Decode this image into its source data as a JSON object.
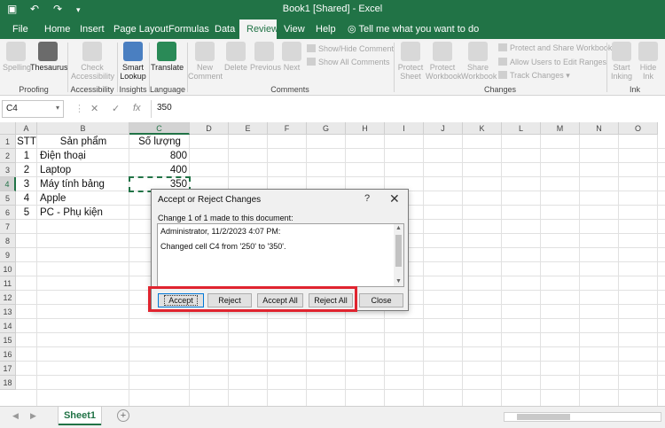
{
  "titlebar": {
    "title": "Book1  [Shared]  -  Excel",
    "save_icon": "save-icon",
    "undo_icon": "undo-icon",
    "redo_icon": "redo-icon",
    "customize_icon": "customize-icon",
    "bg_color": "#217346"
  },
  "tabs": [
    {
      "label": "File"
    },
    {
      "label": "Home"
    },
    {
      "label": "Insert"
    },
    {
      "label": "Page Layout"
    },
    {
      "label": "Formulas"
    },
    {
      "label": "Data"
    },
    {
      "label": "Review"
    },
    {
      "label": "View"
    },
    {
      "label": "Help"
    }
  ],
  "active_tab": "Review",
  "tell_me": "Tell me what you want to do",
  "ribbon": {
    "spelling": "Spelling",
    "thesaurus": "Thesaurus",
    "check_accessibility_1": "Check",
    "check_accessibility_2": "Accessibility",
    "smart_lookup_1": "Smart",
    "smart_lookup_2": "Lookup",
    "translate": "Translate",
    "new_comment_1": "New",
    "new_comment_2": "Comment",
    "delete": "Delete",
    "previous": "Previous",
    "next": "Next",
    "show_hide_comment": "Show/Hide Comment",
    "show_all_comments": "Show All Comments",
    "protect_sheet_1": "Protect",
    "protect_sheet_2": "Sheet",
    "protect_workbook_1": "Protect",
    "protect_workbook_2": "Workbook",
    "share_workbook_1": "Share",
    "share_workbook_2": "Workbook",
    "protect_share": "Protect and Share Workbook",
    "allow_users": "Allow Users to Edit Ranges",
    "track_changes": "Track Changes",
    "start_inking_1": "Start",
    "start_inking_2": "Inking",
    "hide_ink_1": "Hide",
    "hide_ink_2": "Ink",
    "groups": {
      "proofing": "Proofing",
      "accessibility": "Accessibility",
      "insights": "Insights",
      "language": "Language",
      "comments": "Comments",
      "changes": "Changes",
      "ink": "Ink"
    }
  },
  "formula_bar": {
    "name_box": "C4",
    "value": "350",
    "cancel": "✕",
    "enter": "✓",
    "fx": "fx"
  },
  "columns": [
    "A",
    "B",
    "C",
    "D",
    "E",
    "F",
    "G",
    "H",
    "I",
    "J",
    "K",
    "L",
    "M",
    "N",
    "O"
  ],
  "rows": [
    "1",
    "2",
    "3",
    "4",
    "5",
    "6",
    "7",
    "8",
    "9",
    "10",
    "11",
    "12",
    "13",
    "14",
    "15",
    "16",
    "17",
    "18"
  ],
  "cells": {
    "header": {
      "stt": "STT",
      "product": "Sản phẩm",
      "quantity": "Số lượng"
    },
    "data": [
      {
        "stt": "1",
        "product": "Điện thoại",
        "quantity": "800"
      },
      {
        "stt": "2",
        "product": "Laptop",
        "quantity": "400"
      },
      {
        "stt": "3",
        "product": "Máy tính bảng",
        "quantity": "350"
      },
      {
        "stt": "4",
        "product": "Apple",
        "quantity": ""
      },
      {
        "stt": "5",
        "product": "PC - Phụ kiện",
        "quantity": ""
      }
    ]
  },
  "sheet_tab": "Sheet1",
  "dialog": {
    "title": "Accept or Reject Changes",
    "help": "?",
    "close": "✕",
    "message": "Change 1 of 1 made to this document:",
    "line1": "Administrator, 11/2/2023 4:07 PM:",
    "line2": "Changed cell C4 from '250' to '350'.",
    "accept": "Accept",
    "reject": "Reject",
    "accept_all": "Accept All",
    "reject_all": "Reject All",
    "close_button": "Close"
  },
  "colors": {
    "accent": "#217346",
    "highlight": "#e0242f"
  }
}
